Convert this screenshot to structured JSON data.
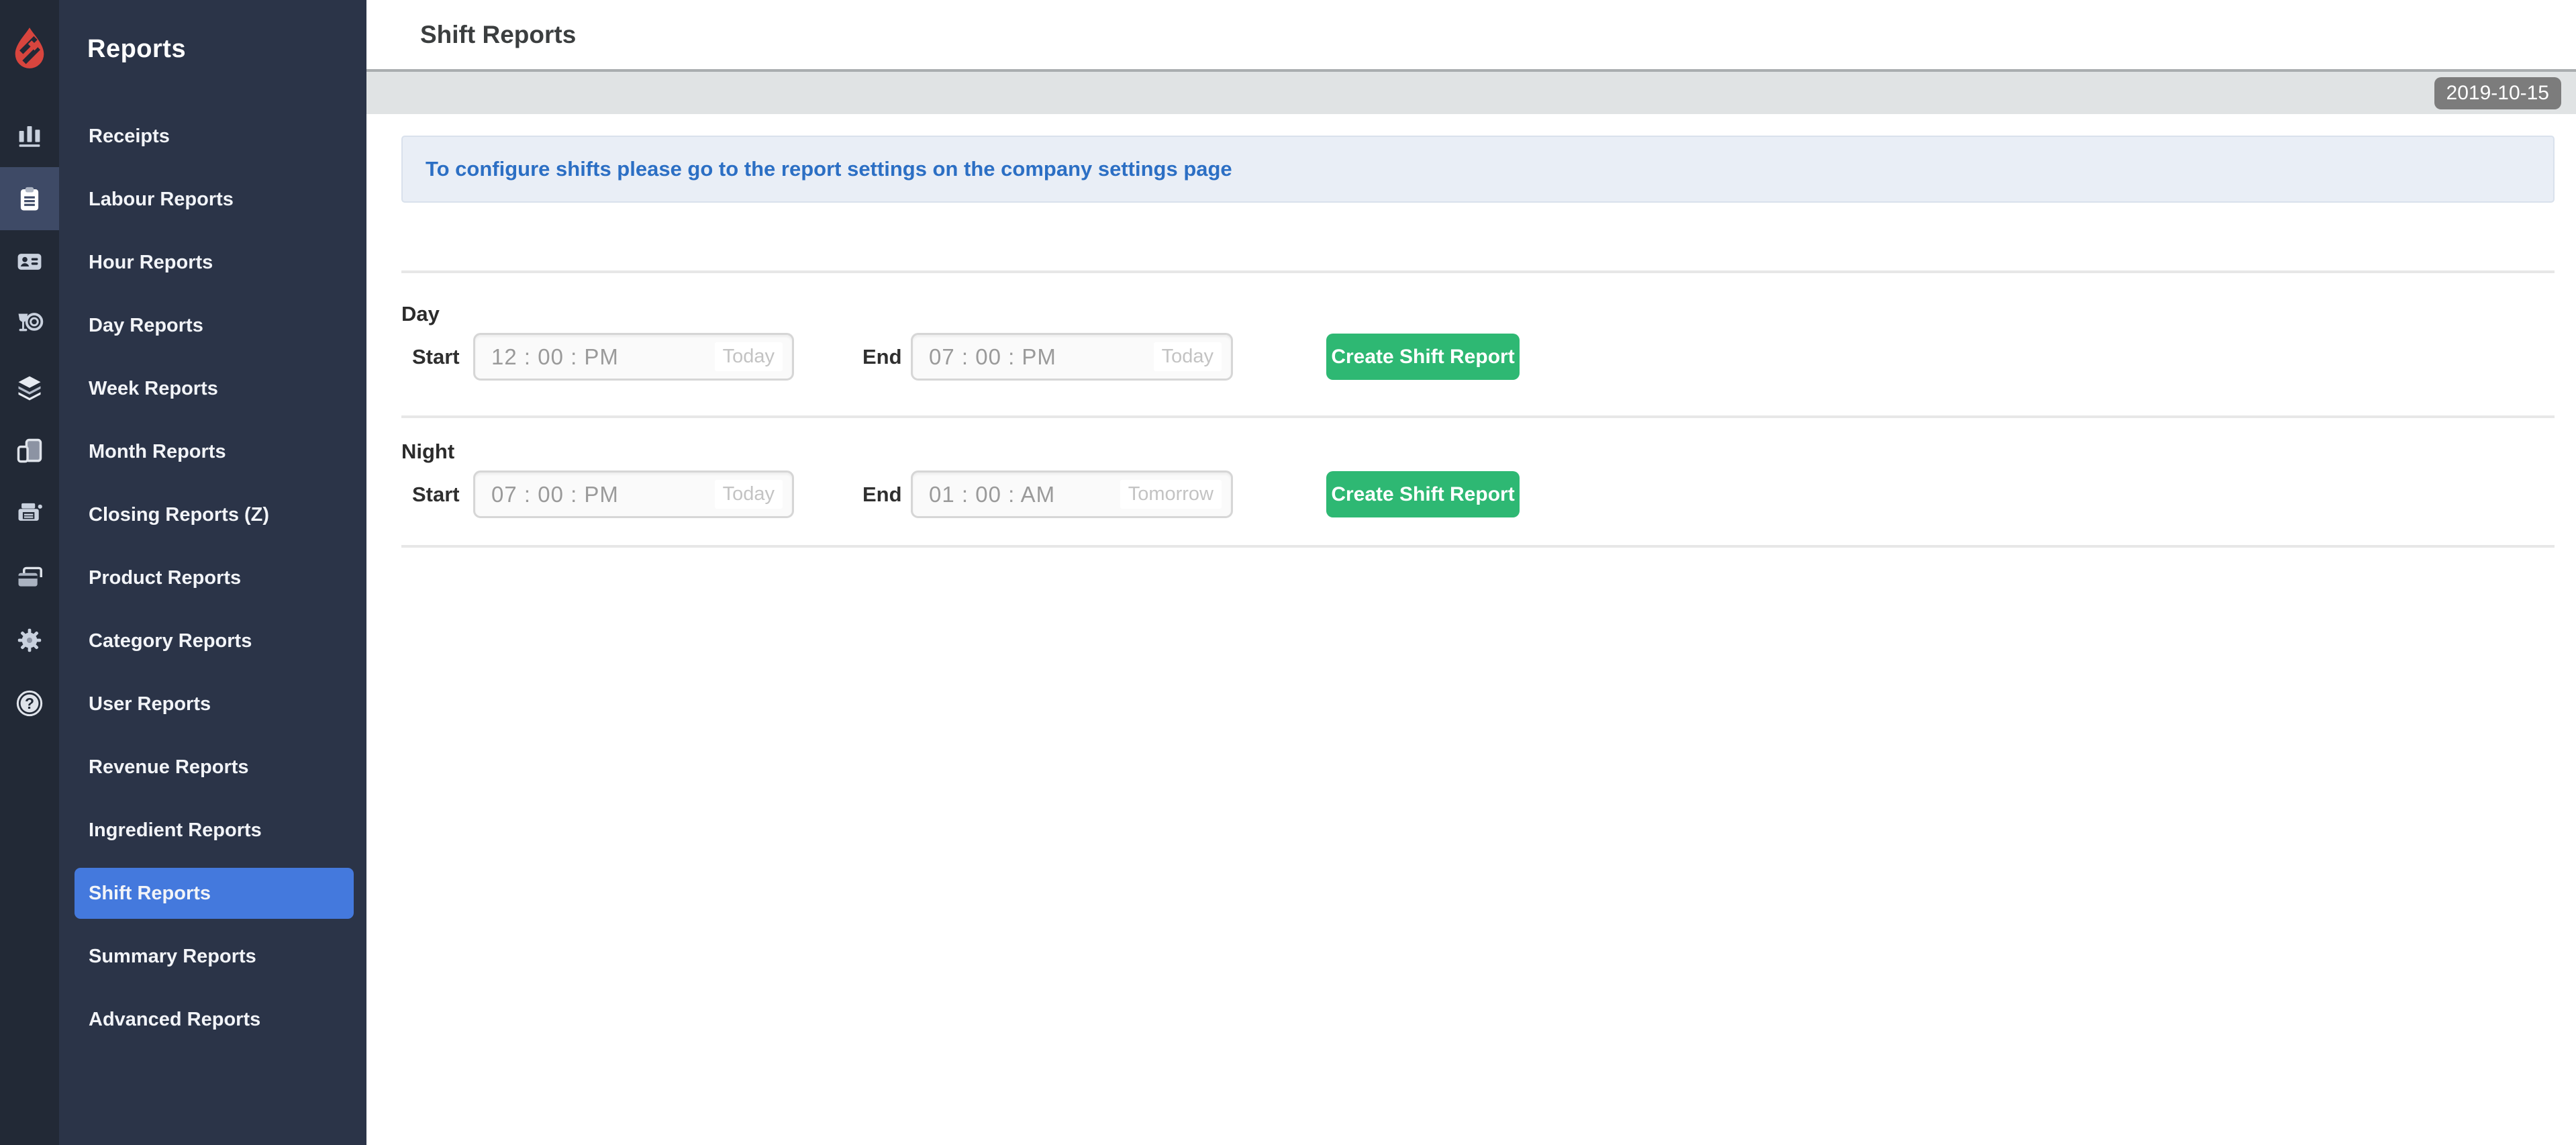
{
  "colors": {
    "sidebar_rail": "#222936",
    "sidebar_menu": "#2b3448",
    "rail_active_cell": "#3e4a66",
    "selected_item_blue": "#4479dd",
    "brand_red": "#d8453e",
    "button_green": "#2eb873",
    "notice_blue_text": "#2c6fc4",
    "notice_bg": "#e9eef6",
    "graybar_bg": "#e0e3e4",
    "badge_gray": "#7c7c7c"
  },
  "sidebar": {
    "title": "Reports",
    "rail_icons": [
      "bar-chart-icon",
      "reports-clipboard-icon",
      "id-card-icon",
      "dining-icon",
      "layers-icon",
      "devices-icon",
      "printer-icon",
      "credit-cards-icon",
      "settings-gear-icon",
      "help-icon"
    ],
    "rail_active_index": 1,
    "items": [
      "Receipts",
      "Labour Reports",
      "Hour Reports",
      "Day Reports",
      "Week Reports",
      "Month Reports",
      "Closing Reports (Z)",
      "Product Reports",
      "Category Reports",
      "User Reports",
      "Revenue Reports",
      "Ingredient Reports",
      "Shift Reports",
      "Summary Reports",
      "Advanced Reports"
    ],
    "selected_index": 12
  },
  "header": {
    "title": "Shift Reports",
    "date_badge": "2019-10-15"
  },
  "notice": {
    "text": "To configure shifts please go to the report settings on the company settings page"
  },
  "sections": [
    {
      "name": "Day",
      "start_label": "Start",
      "end_label": "End",
      "start": {
        "time": "12 : 00 : PM",
        "day": "Today"
      },
      "end": {
        "time": "07 : 00 : PM",
        "day": "Today"
      },
      "button": "Create Shift Report"
    },
    {
      "name": "Night",
      "start_label": "Start",
      "end_label": "End",
      "start": {
        "time": "07 : 00 : PM",
        "day": "Today"
      },
      "end": {
        "time": "01 : 00 : AM",
        "day": "Tomorrow"
      },
      "button": "Create Shift Report"
    }
  ]
}
